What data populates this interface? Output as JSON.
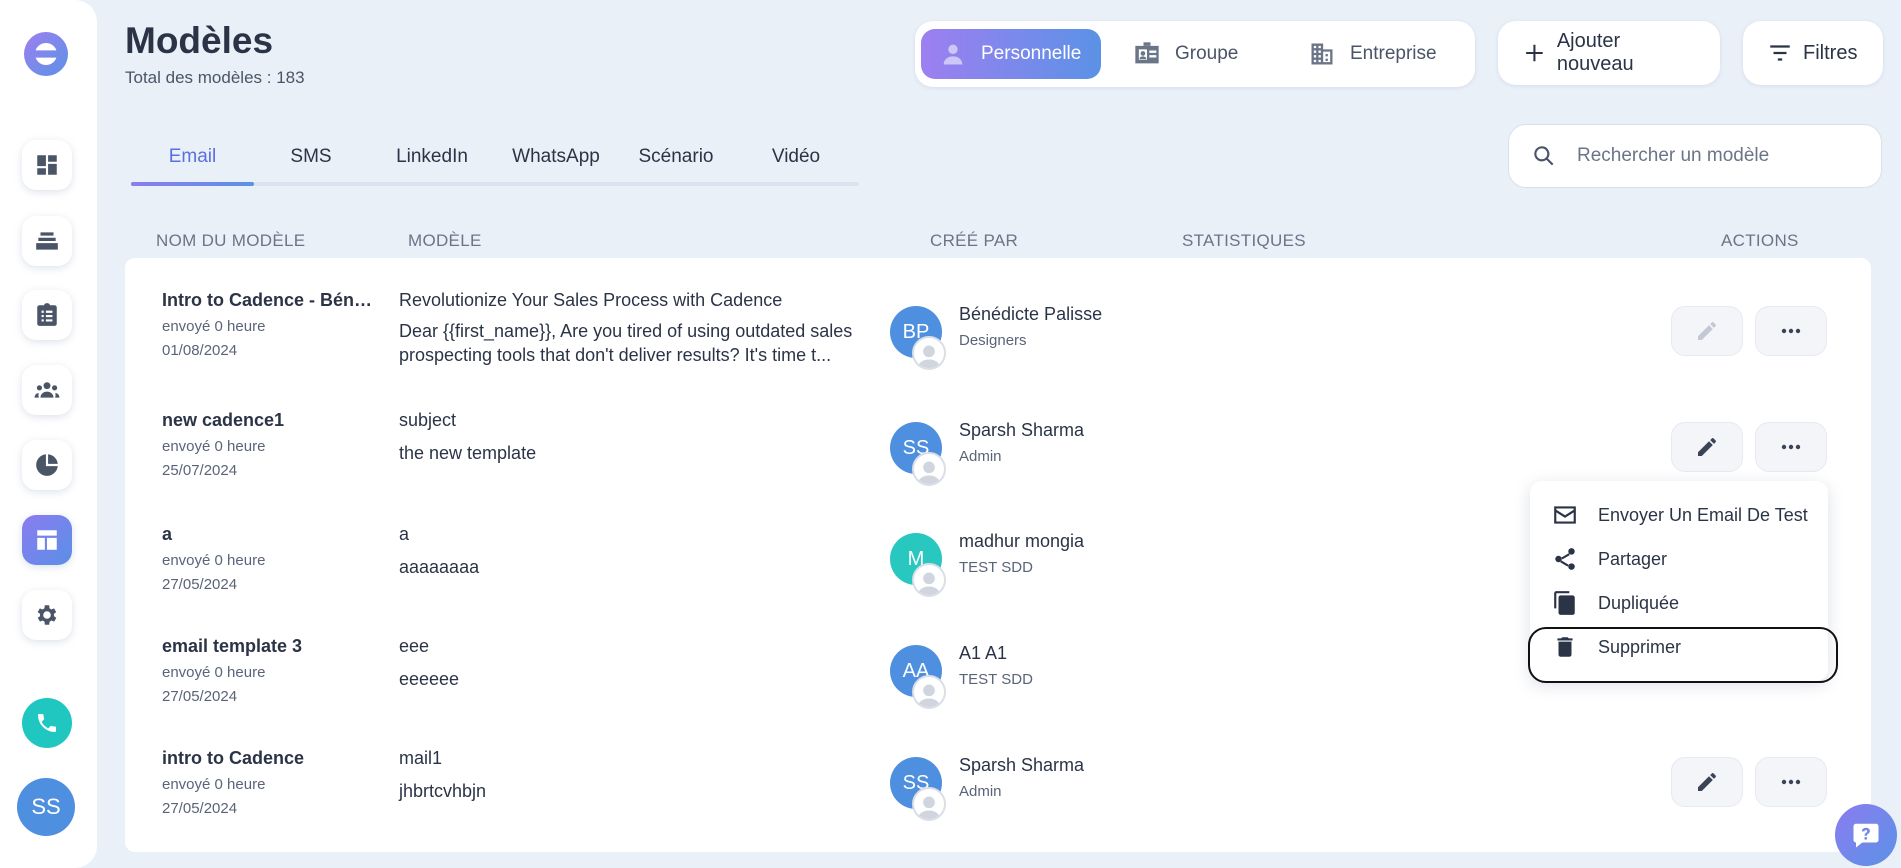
{
  "header": {
    "title": "Modèles",
    "subtitle": "Total des modèles : 183"
  },
  "scope_tabs": [
    {
      "label": "Personnelle",
      "active": true,
      "icon": "person-icon"
    },
    {
      "label": "Groupe",
      "active": false,
      "icon": "id-card-icon"
    },
    {
      "label": "Entreprise",
      "active": false,
      "icon": "building-icon"
    }
  ],
  "actions": {
    "add_label": "Ajouter nouveau",
    "filter_label": "Filtres"
  },
  "tabs": [
    {
      "label": "Email",
      "active": true
    },
    {
      "label": "SMS",
      "active": false
    },
    {
      "label": "LinkedIn",
      "active": false
    },
    {
      "label": "WhatsApp",
      "active": false
    },
    {
      "label": "Scénario",
      "active": false
    },
    {
      "label": "Vidéo",
      "active": false
    }
  ],
  "search": {
    "placeholder": "Rechercher un modèle",
    "value": ""
  },
  "columns": {
    "name": "NOM DU MODÈLE",
    "template": "MODÈLE",
    "created_by": "CRÉÉ PAR",
    "stats": "STATISTIQUES",
    "actions": "ACTIONS"
  },
  "rows": [
    {
      "name": "Intro to Cadence - Béné...",
      "sent": "envoyé 0 heure",
      "date": "01/08/2024",
      "subject": "Revolutionize Your Sales Process with Cadence",
      "body": "Dear {{first_name}},   Are you tired of using outdated sales prospecting tools that don't deliver results? It's time t...",
      "initials": "BP",
      "avatar_color": "#4f8fe0",
      "creator": "Bénédicte Palisse",
      "role": "Designers",
      "edit_disabled": true
    },
    {
      "name": "new cadence1",
      "sent": "envoyé 0 heure",
      "date": "25/07/2024",
      "subject": "subject",
      "body": "the new template",
      "initials": "SS",
      "avatar_color": "#4f8fe0",
      "creator": "Sparsh Sharma",
      "role": "Admin",
      "edit_disabled": false
    },
    {
      "name": "a",
      "sent": "envoyé 0 heure",
      "date": "27/05/2024",
      "subject": "a",
      "body": "aaaaaaaa",
      "initials": "M",
      "avatar_color": "#28c7c0",
      "creator": "madhur mongia",
      "role": "TEST SDD",
      "edit_disabled": false
    },
    {
      "name": "email template 3",
      "sent": "envoyé 0 heure",
      "date": "27/05/2024",
      "subject": "eee",
      "body": "eeeeee",
      "initials": "AA",
      "avatar_color": "#4f8fe0",
      "creator": "A1 A1",
      "role": "TEST SDD",
      "edit_disabled": false
    },
    {
      "name": "intro to Cadence",
      "sent": "envoyé 0 heure",
      "date": "27/05/2024",
      "subject": "mail1",
      "body": "jhbrtcvhbjn",
      "initials": "SS",
      "avatar_color": "#4f8fe0",
      "creator": "Sparsh Sharma",
      "role": "Admin",
      "edit_disabled": false
    }
  ],
  "dropdown": {
    "items": [
      {
        "label": "Envoyer Un Email De Test",
        "icon": "mail-icon"
      },
      {
        "label": "Partager",
        "icon": "share-icon"
      },
      {
        "label": "Dupliquée",
        "icon": "copy-icon"
      },
      {
        "label": "Supprimer",
        "icon": "trash-icon"
      }
    ],
    "highlighted": "Supprimer"
  },
  "sidebar": {
    "items": [
      "dashboard-icon",
      "cadences-icon",
      "tasks-icon",
      "people-icon",
      "reports-icon",
      "templates-icon",
      "settings-icon"
    ],
    "active": "templates-icon",
    "user_initials": "SS"
  },
  "colors": {
    "accent": "#5b6fe0",
    "background": "#eaf0f8",
    "teal": "#20c6c0"
  }
}
